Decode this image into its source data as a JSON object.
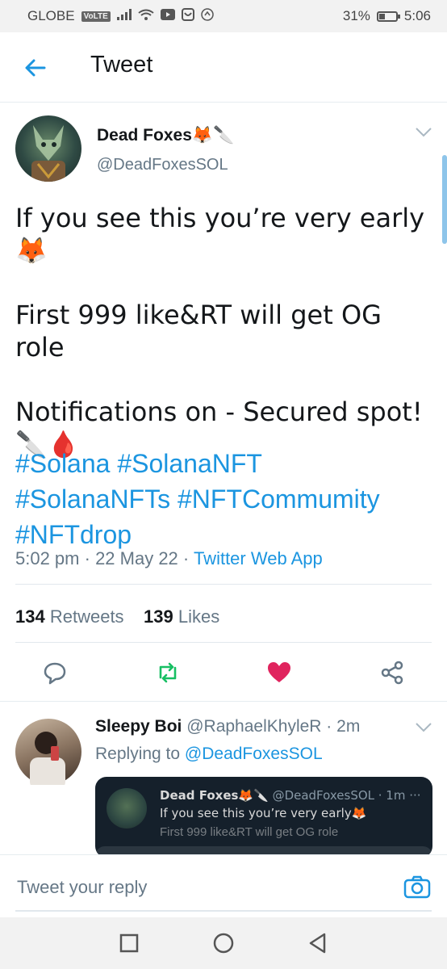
{
  "status_bar": {
    "carrier": "GLOBE",
    "network_badge": "VoLTE",
    "battery": "31%",
    "time": "5:06"
  },
  "header": {
    "title": "Tweet",
    "back_icon": "arrow-left-icon"
  },
  "tweet": {
    "author_name": "Dead Foxes",
    "author_emojis": "🦊🔪",
    "author_handle": "@DeadFoxesSOL",
    "body": "If you see this you’re very early\n🦊\n\nFirst 999 like&RT will get OG role\n\nNotifications on - Secured spot!\n🔪🩸",
    "hashtags": "#Solana #SolanaNFT\n#SolanaNFTs  #NFTCommumity\n#NFTdrop",
    "time": "5:02 pm",
    "date": "22 May 22",
    "source": "Twitter Web App",
    "retweets_count": "134",
    "retweets_label": "Retweets",
    "likes_count": "139",
    "likes_label": "Likes",
    "like_color": "#e0245e",
    "retweet_color": "#17bf63"
  },
  "reply": {
    "author_name": "Sleepy Boi",
    "author_handle": "@RaphaelKhyleR",
    "time_ago": "2m",
    "replying_label": "Replying to",
    "replying_to": "@DeadFoxesSOL",
    "quote": {
      "name": "Dead Foxes🦊🔪",
      "handle_time": "@DeadFoxesSOL · 1m",
      "more": "···",
      "text": "If you see this you’re very early🦊",
      "text_cut": "First 999 like&RT will get OG role"
    }
  },
  "compose": {
    "placeholder": "Tweet your reply"
  },
  "accent": "#1b95e0"
}
